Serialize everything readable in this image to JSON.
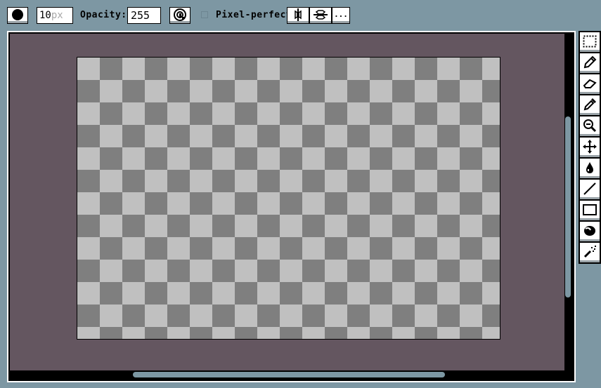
{
  "toolbar": {
    "brush_size_value": "10",
    "brush_size_unit": "px",
    "opacity_label": "Opacity:",
    "opacity_value": "255",
    "pixel_perfect_label": "Pixel-perfect",
    "more_label": "..."
  },
  "colors": {
    "background": "#7d97a3",
    "canvas_bg": "#645660",
    "checker_light": "#c0c0c0",
    "checker_dark": "#7f7f7f",
    "button_shadow": "#9aa3a8"
  },
  "tools": [
    {
      "icon": "marquee-icon"
    },
    {
      "icon": "pencil-icon"
    },
    {
      "icon": "eraser-icon"
    },
    {
      "icon": "eyedropper-icon"
    },
    {
      "icon": "zoom-icon"
    },
    {
      "icon": "move-icon"
    },
    {
      "icon": "paint-bucket-icon"
    },
    {
      "icon": "line-icon"
    },
    {
      "icon": "rectangle-icon"
    },
    {
      "icon": "ellipse-icon"
    },
    {
      "icon": "spray-icon"
    }
  ]
}
